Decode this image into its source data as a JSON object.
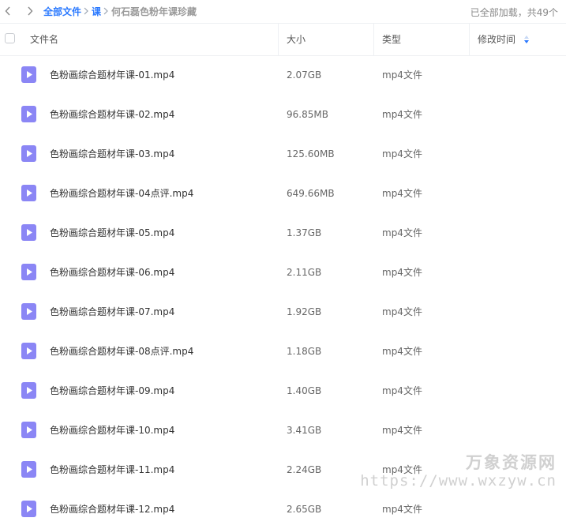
{
  "breadcrumb": {
    "all_files": "全部文件",
    "folder": "课",
    "current": "何石磊色粉年课珍藏"
  },
  "status_text": "已全部加载，共49个",
  "columns": {
    "name": "文件名",
    "size": "大小",
    "type": "类型",
    "modified": "修改时间"
  },
  "files": [
    {
      "name": "色粉画综合题材年课-01.mp4",
      "size": "2.07GB",
      "type": "mp4文件",
      "icon": "video-file-icon"
    },
    {
      "name": "色粉画综合题材年课-02.mp4",
      "size": "96.85MB",
      "type": "mp4文件",
      "icon": "video-file-icon"
    },
    {
      "name": "色粉画综合题材年课-03.mp4",
      "size": "125.60MB",
      "type": "mp4文件",
      "icon": "video-file-icon"
    },
    {
      "name": "色粉画综合题材年课-04点评.mp4",
      "size": "649.66MB",
      "type": "mp4文件",
      "icon": "video-file-icon"
    },
    {
      "name": "色粉画综合题材年课-05.mp4",
      "size": "1.37GB",
      "type": "mp4文件",
      "icon": "video-file-icon"
    },
    {
      "name": "色粉画综合题材年课-06.mp4",
      "size": "2.11GB",
      "type": "mp4文件",
      "icon": "video-file-icon"
    },
    {
      "name": "色粉画综合题材年课-07.mp4",
      "size": "1.92GB",
      "type": "mp4文件",
      "icon": "video-file-icon"
    },
    {
      "name": "色粉画综合题材年课-08点评.mp4",
      "size": "1.18GB",
      "type": "mp4文件",
      "icon": "video-file-icon"
    },
    {
      "name": "色粉画综合题材年课-09.mp4",
      "size": "1.40GB",
      "type": "mp4文件",
      "icon": "video-file-icon"
    },
    {
      "name": "色粉画综合题材年课-10.mp4",
      "size": "3.41GB",
      "type": "mp4文件",
      "icon": "video-file-icon"
    },
    {
      "name": "色粉画综合题材年课-11.mp4",
      "size": "2.24GB",
      "type": "mp4文件",
      "icon": "video-file-icon"
    },
    {
      "name": "色粉画综合题材年课-12.mp4",
      "size": "2.65GB",
      "type": "mp4文件",
      "icon": "video-file-icon"
    }
  ],
  "watermark": {
    "line1": "万象资源网",
    "line2": "https://www.wxzyw.cn"
  },
  "colors": {
    "accent": "#2a79ff",
    "file_icon": "#8b86f5",
    "muted": "#9a9a9a"
  }
}
